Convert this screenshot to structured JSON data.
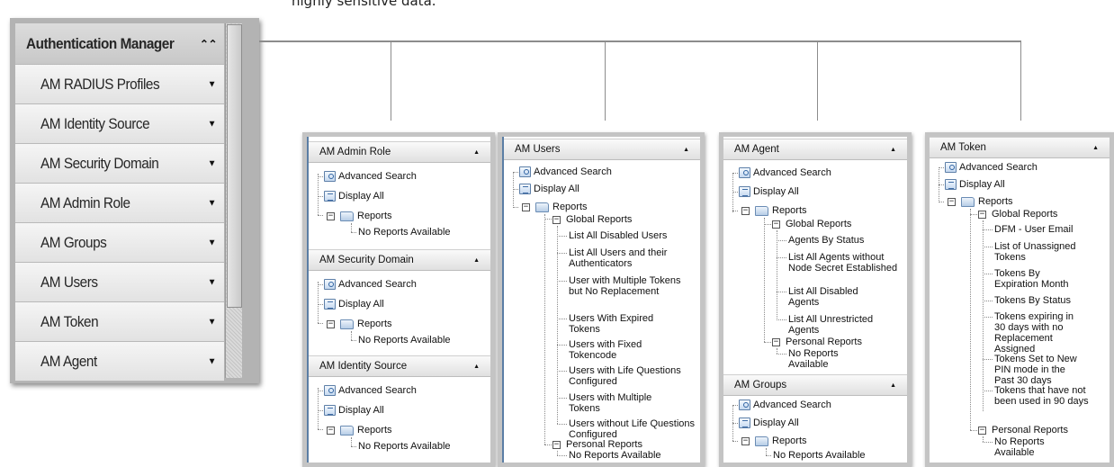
{
  "intro_text": "highly sensitive data.",
  "nav": {
    "header": "Authentication Manager",
    "header_icon": "double-chevron-up-icon",
    "items": [
      {
        "label": "AM RADIUS Profiles"
      },
      {
        "label": "AM Identity Source"
      },
      {
        "label": "AM Security Domain"
      },
      {
        "label": "AM Admin Role"
      },
      {
        "label": "AM Groups"
      },
      {
        "label": "AM Users"
      },
      {
        "label": "AM Token"
      },
      {
        "label": "AM Agent"
      }
    ],
    "chevron_glyph": "▼",
    "header_glyph": "⌃"
  },
  "common": {
    "advanced_search": "Advanced Search",
    "display_all": "Display All",
    "reports": "Reports",
    "global_reports": "Global Reports",
    "personal_reports": "Personal Reports",
    "no_reports": "No Reports Available",
    "collapse_glyph": "▲",
    "minus": "−"
  },
  "panels": {
    "admin_role": {
      "title": "AM Admin Role"
    },
    "security_domain": {
      "title": "AM Security Domain"
    },
    "identity_source": {
      "title": "AM Identity Source"
    },
    "users": {
      "title": "AM Users",
      "global": [
        "List All Disabled Users",
        "List All Users and their Authenticators",
        "User with Multiple Tokens but No Replacement",
        "Users With Expired Tokens",
        "Users with Fixed Tokencode",
        "Users with Life Questions Configured",
        "Users with Multiple Tokens",
        "Users without Life Questions Configured"
      ]
    },
    "agent": {
      "title": "AM Agent",
      "global": [
        "Agents By Status",
        "List All Agents without Node Secret Established",
        "List All Disabled Agents",
        "List All Unrestricted Agents"
      ],
      "personal_none": "No Reports Available"
    },
    "groups": {
      "title": "AM Groups"
    },
    "token": {
      "title": "AM Token",
      "global": [
        "DFM - User Email",
        "List of Unassigned Tokens",
        "Tokens By Expiration Month",
        "Tokens By Status",
        "Tokens expiring in 30 days with no Replacement Assigned",
        "Tokens Set to New PIN mode in the Past 30 days",
        "Tokens that have not been used in 90 days"
      ],
      "personal_none": "No Reports Available"
    }
  }
}
